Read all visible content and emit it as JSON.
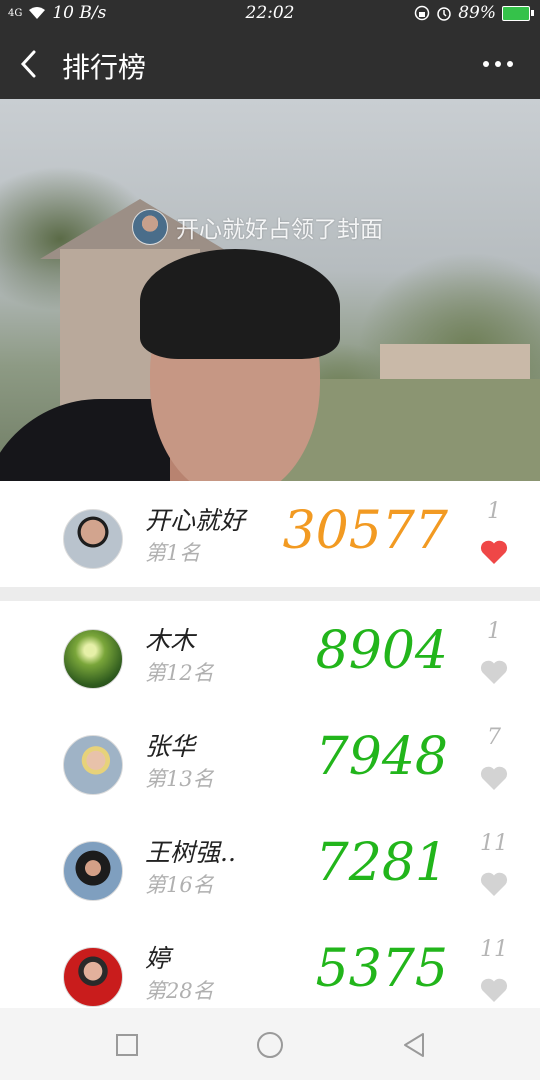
{
  "status_bar": {
    "signal": "4G",
    "speed": "10 B/s",
    "time": "22:02",
    "battery": "89%"
  },
  "header": {
    "title": "排行榜"
  },
  "cover": {
    "caption": "开心就好占领了封面"
  },
  "colors": {
    "top_score": "#f29a22",
    "score": "#22b51b",
    "liked_heart": "#ef4747",
    "heart": "#d3d3d3"
  },
  "top_entry": {
    "name": "开心就好",
    "rank": "第1名",
    "score": "30577",
    "likes": "1",
    "liked": true
  },
  "entries": [
    {
      "name": "木木",
      "rank": "第12名",
      "score": "8904",
      "likes": "1",
      "liked": false
    },
    {
      "name": "张华",
      "rank": "第13名",
      "score": "7948",
      "likes": "7",
      "liked": false
    },
    {
      "name": "王树强..",
      "rank": "第16名",
      "score": "7281",
      "likes": "11",
      "liked": false
    },
    {
      "name": "婷",
      "rank": "第28名",
      "score": "5375",
      "likes": "11",
      "liked": false
    }
  ]
}
